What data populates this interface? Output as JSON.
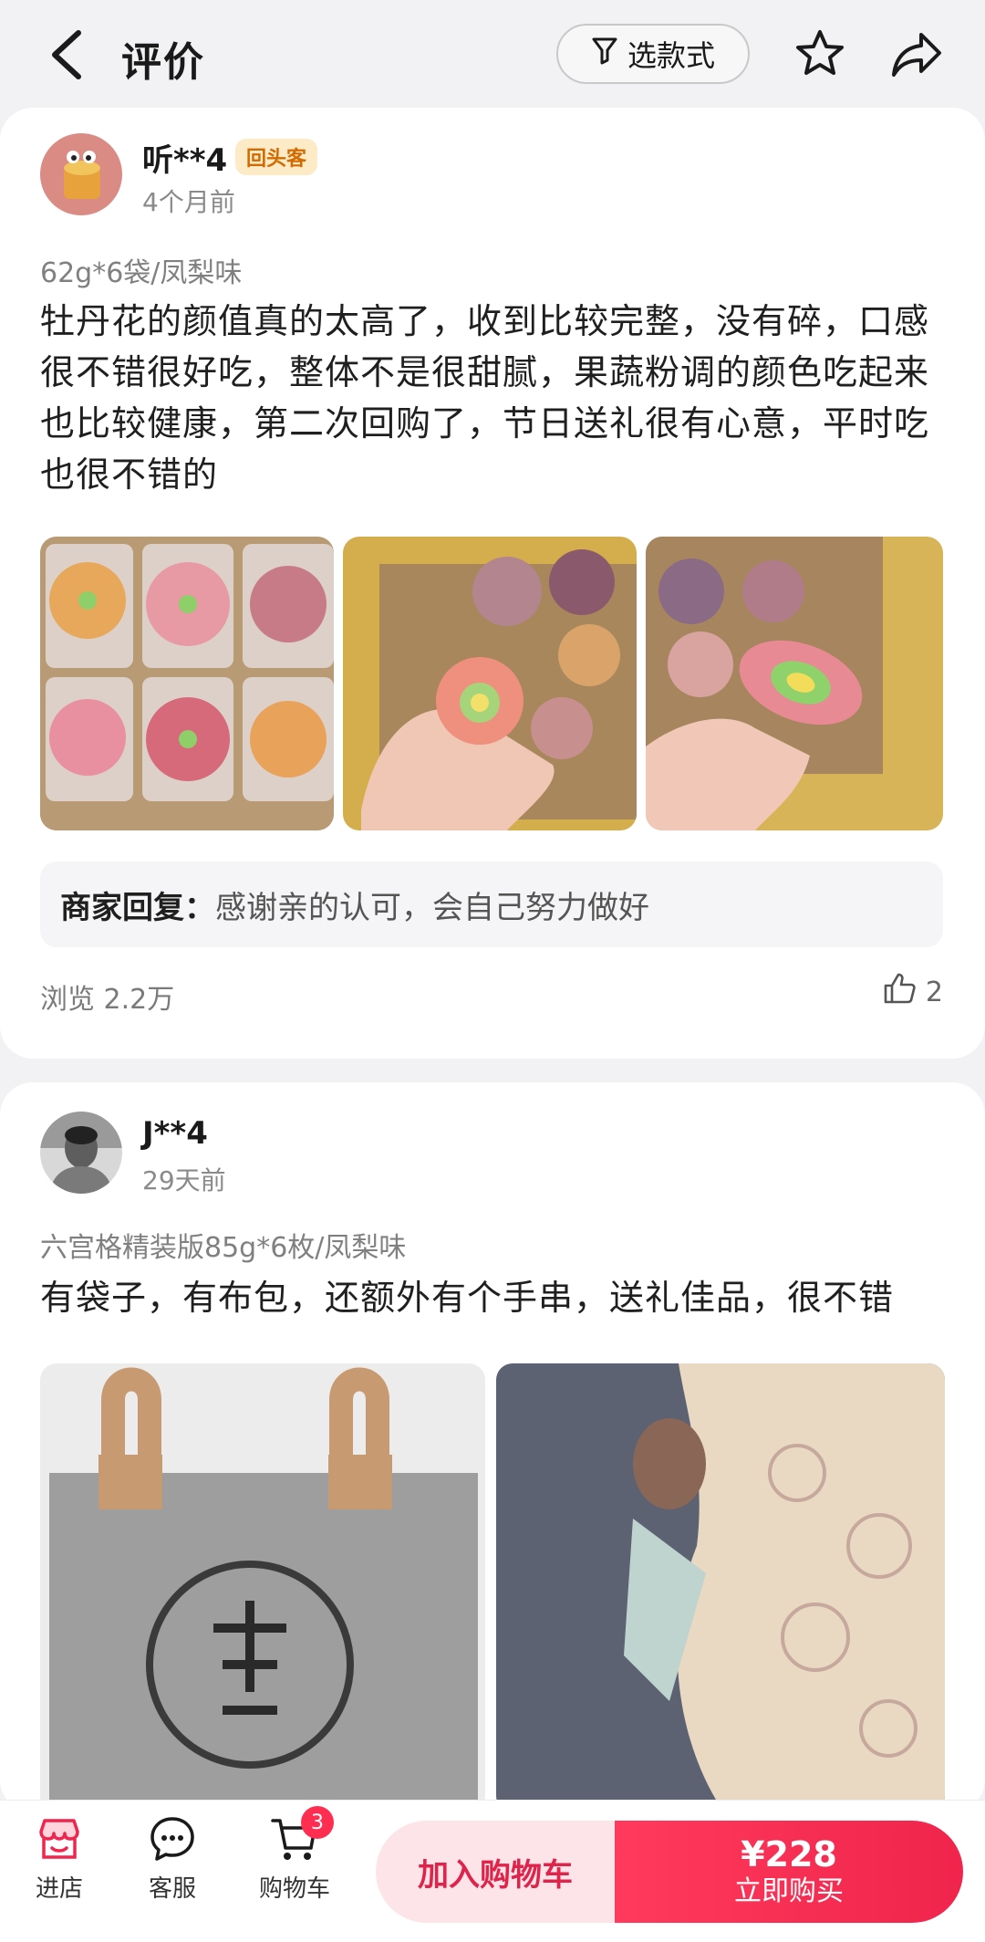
{
  "header": {
    "title": "评价",
    "filter_label": "选款式"
  },
  "reviews": [
    {
      "username": "听**4",
      "badge": "回头客",
      "time": "4个月前",
      "spec": "62g*6袋/凤梨味",
      "text": "牡丹花的颜值真的太高了，收到比较完整，没有碎，口感很不错很好吃，整体不是很甜腻，果蔬粉调的颜色吃起来也比较健康，第二次回购了，节日送礼很有心意，平时吃也很不错的",
      "reply_label": "商家回复：",
      "reply_text": "感谢亲的认可，会自己努力做好",
      "views": "浏览 2.2万",
      "likes": "2"
    },
    {
      "username": "J**4",
      "time": "29天前",
      "spec": "六宫格精装版85g*6枚/凤梨味",
      "text": "有袋子，有布包，还额外有个手串，送礼佳品，很不错"
    }
  ],
  "bottom_bar": {
    "store_label": "进店",
    "service_label": "客服",
    "cart_label": "购物车",
    "cart_count": "3",
    "add_cart_label": "加入购物车",
    "price": "¥228",
    "buy_label": "立即购买"
  },
  "colors": {
    "accent": "#f0244c",
    "badge_bg": "#fdebc8",
    "badge_text": "#d26a00"
  }
}
